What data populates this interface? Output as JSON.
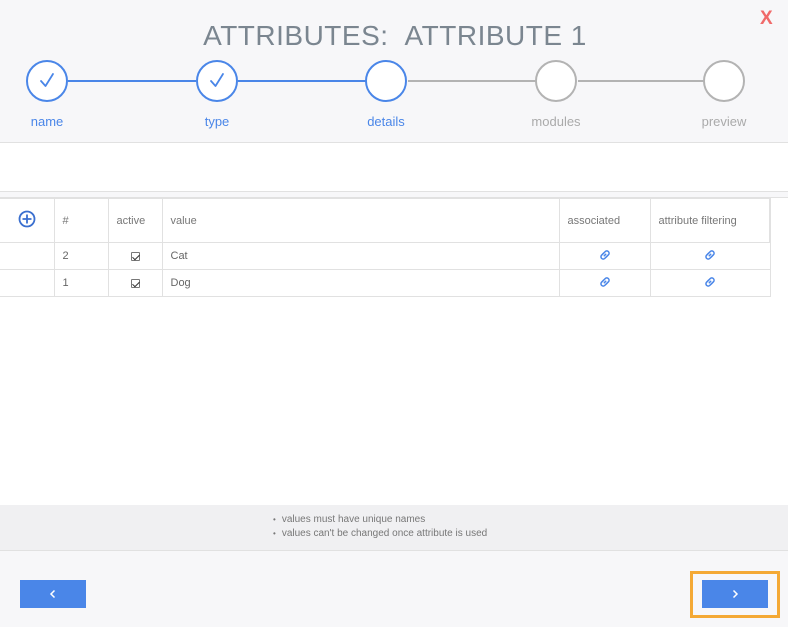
{
  "dialog": {
    "title_prefix": "ATTRIBUTES:",
    "title_name": "ATTRIBUTE 1",
    "close_label": "X"
  },
  "steps": [
    {
      "label": "name",
      "state": "done"
    },
    {
      "label": "type",
      "state": "done"
    },
    {
      "label": "details",
      "state": "current"
    },
    {
      "label": "modules",
      "state": "pending"
    },
    {
      "label": "preview",
      "state": "pending"
    }
  ],
  "table": {
    "headers": {
      "number": "#",
      "active": "active",
      "value": "value",
      "associated": "associated",
      "filtering": "attribute filtering"
    },
    "rows": [
      {
        "number": "2",
        "active": true,
        "value": "Cat"
      },
      {
        "number": "1",
        "active": true,
        "value": "Dog"
      }
    ]
  },
  "notes": [
    "values must have unique names",
    "values can't be changed once attribute is used"
  ],
  "colors": {
    "accent": "#4a86e8",
    "inactive": "#b3b3b3",
    "close": "#f06a6a",
    "highlight": "#f4a935"
  },
  "icons": {
    "add": "plus-circle-icon",
    "link": "link-icon",
    "prev": "chevron-left-icon",
    "next": "chevron-right-icon",
    "check": "check-icon"
  }
}
